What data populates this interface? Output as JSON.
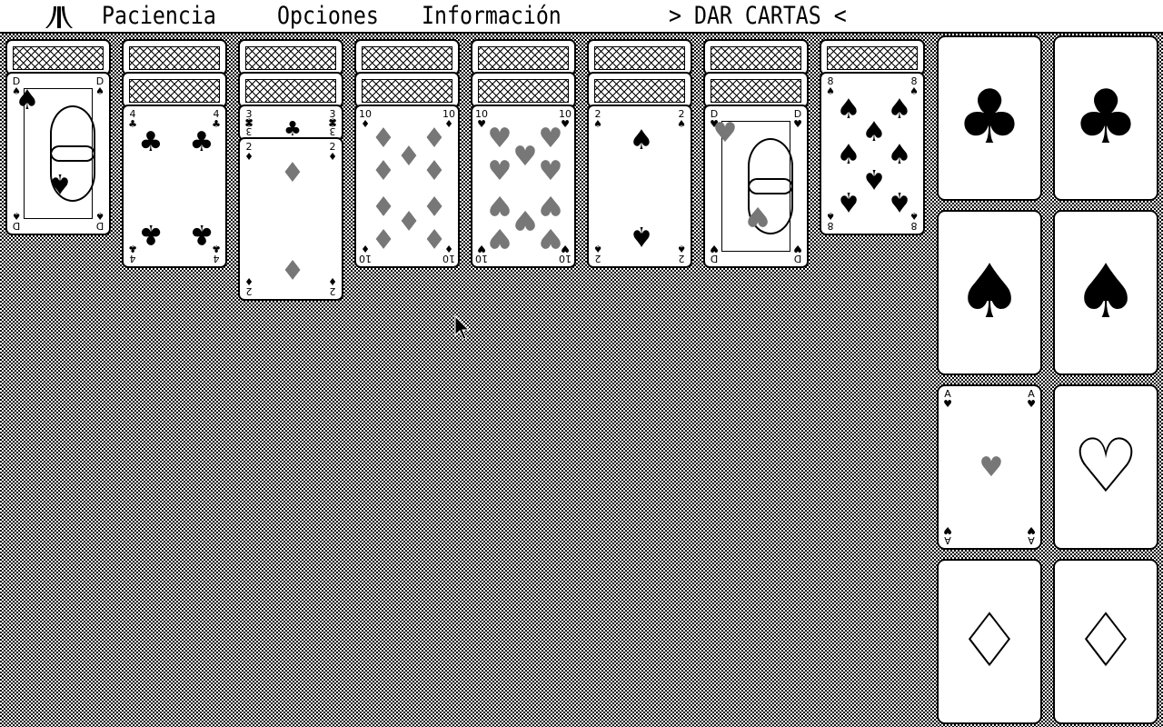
{
  "menubar": {
    "logo": "atari-logo-icon",
    "items": [
      "Paciencia",
      "Opciones",
      "Información"
    ],
    "action": "> DAR CARTAS <"
  },
  "tableau": [
    {
      "hidden": 1,
      "top": {
        "rank": "D",
        "suit": "♠",
        "color": "black",
        "kind": "court"
      }
    },
    {
      "hidden": 2,
      "top": {
        "rank": "4",
        "suit": "♣",
        "color": "black",
        "kind": "pips"
      }
    },
    {
      "hidden": 2,
      "partial": {
        "rank": "3",
        "suit": "♣"
      },
      "top": {
        "rank": "2",
        "suit": "♦",
        "color": "red",
        "kind": "pips"
      }
    },
    {
      "hidden": 2,
      "top": {
        "rank": "10",
        "suit": "♦",
        "color": "red",
        "kind": "pips"
      }
    },
    {
      "hidden": 2,
      "top": {
        "rank": "10",
        "suit": "♥",
        "color": "red",
        "kind": "pips"
      }
    },
    {
      "hidden": 2,
      "top": {
        "rank": "2",
        "suit": "♠",
        "color": "black",
        "kind": "pips"
      }
    },
    {
      "hidden": 2,
      "top": {
        "rank": "D",
        "suit": "♥",
        "color": "red",
        "kind": "court"
      }
    },
    {
      "hidden": 1,
      "top": {
        "rank": "8",
        "suit": "♠",
        "color": "black",
        "kind": "pips"
      }
    }
  ],
  "foundations": [
    {
      "suit": "♣",
      "card": null
    },
    {
      "suit": "♣",
      "card": null
    },
    {
      "suit": "♠",
      "card": null
    },
    {
      "suit": "♠",
      "card": null
    },
    {
      "suit": "♥",
      "card": {
        "rank": "A",
        "suit": "♥"
      }
    },
    {
      "suit": "♡",
      "card": null
    },
    {
      "suit": "♢",
      "card": null
    },
    {
      "suit": "♢",
      "card": null
    }
  ],
  "colors": {
    "table_dark": "#000000",
    "table_light": "#ffffff",
    "card": "#ffffff",
    "red_suit": "#777777"
  }
}
